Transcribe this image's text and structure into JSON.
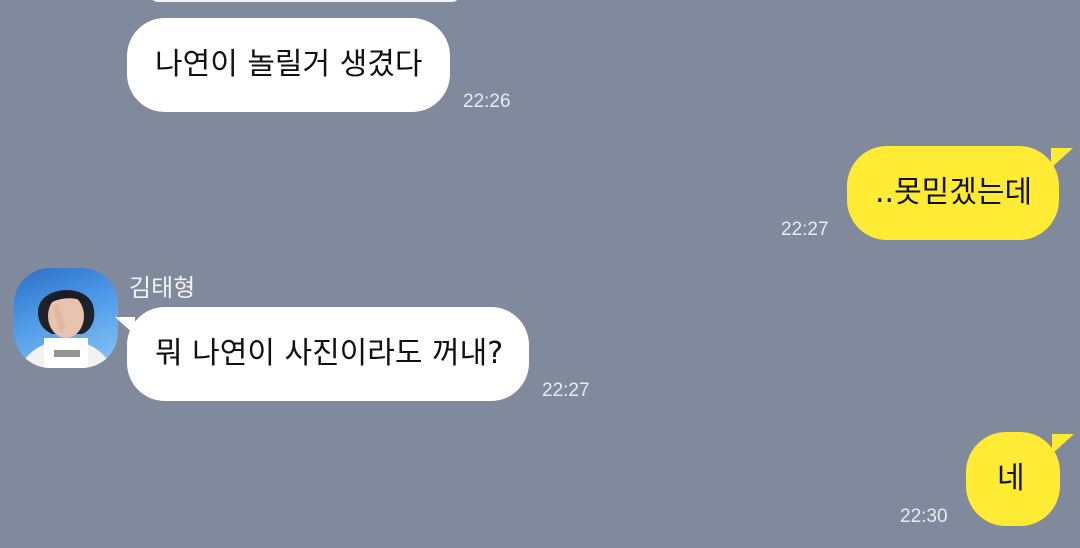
{
  "chat": {
    "messages": [
      {
        "direction": "incoming",
        "text": "나연이 놀릴거 생겼다",
        "time": "22:26"
      },
      {
        "direction": "outgoing",
        "text": "..못믿겠는데",
        "time": "22:27"
      },
      {
        "direction": "incoming",
        "sender": "김태형",
        "avatar_icon": "profile-photo-icon",
        "text": "뭐 나연이 사진이라도 꺼내?",
        "time": "22:27"
      },
      {
        "direction": "outgoing",
        "text": "네",
        "time": "22:30"
      }
    ]
  },
  "colors": {
    "background": "#818a9c",
    "incoming_bubble": "#ffffff",
    "outgoing_bubble": "#ffeb34"
  }
}
